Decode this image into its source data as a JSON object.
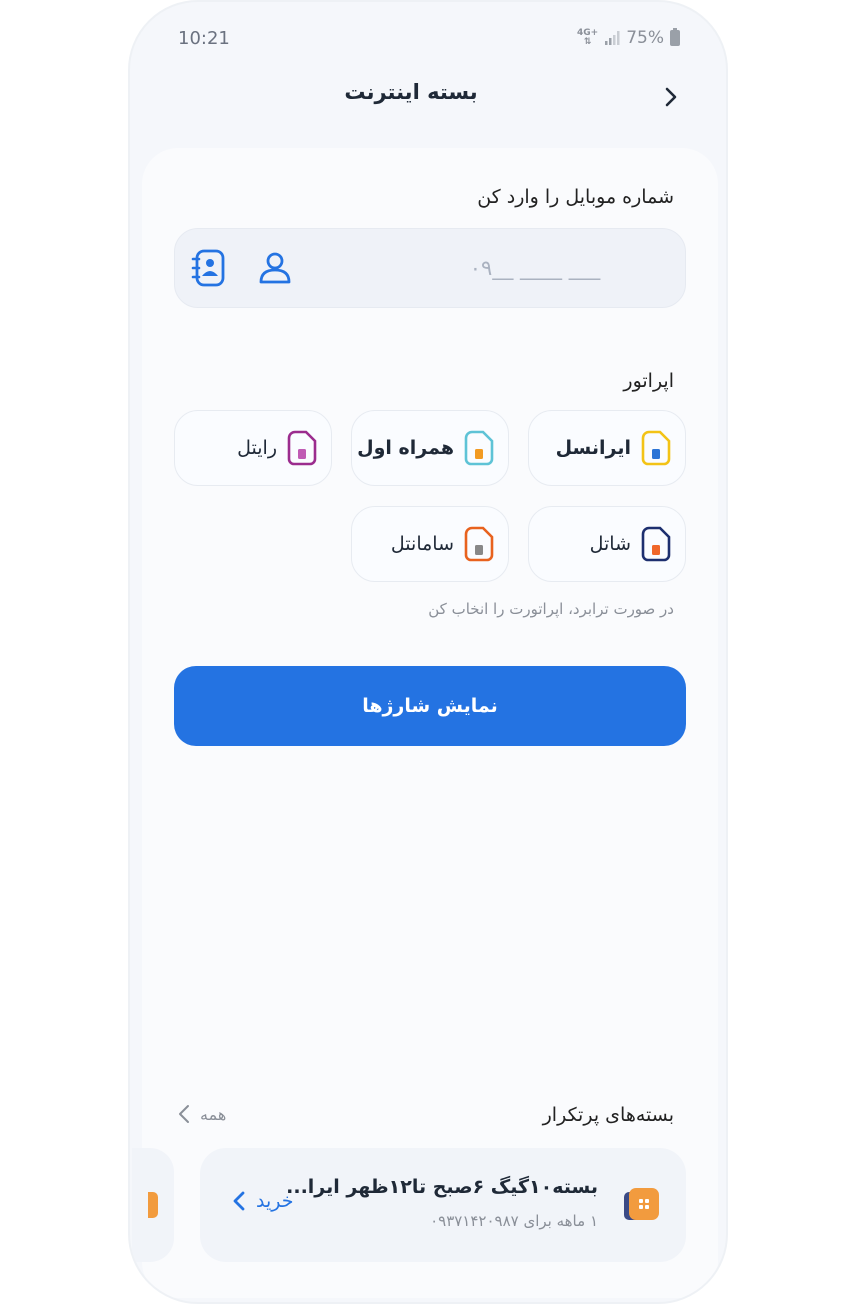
{
  "status_bar": {
    "time": "10:21",
    "network": "4G+",
    "battery": "75%"
  },
  "header": {
    "title": "بسته اینترنت"
  },
  "mobile": {
    "label": "شماره موبایل را وارد کن",
    "placeholder": "۰۹__ ____ ___",
    "value": ""
  },
  "operator": {
    "label": "اپراتور",
    "items": [
      {
        "name": "ایرانسل",
        "icon": "irancell-sim-icon",
        "frame_color": "#f3c316",
        "chip_color": "#2b74d6"
      },
      {
        "name": "همراه اول",
        "icon": "hamrahe-aval-sim-icon",
        "frame_color": "#5ec3d6",
        "chip_color": "#f29b22"
      },
      {
        "name": "رایتل",
        "icon": "rightel-sim-icon",
        "frame_color": "#9b2c8e",
        "chip_color": "#c05bb4"
      },
      {
        "name": "شاتل",
        "icon": "shatel-sim-icon",
        "frame_color": "#1d2f6f",
        "chip_color": "#f0672a"
      },
      {
        "name": "سامانتل",
        "icon": "samantel-sim-icon",
        "frame_color": "#e8621e",
        "chip_color": "#888888"
      }
    ],
    "hint": "در صورت ترابرد، اپراتورت را انخاب کن"
  },
  "submit": {
    "label": "نمایش شارژها"
  },
  "frequent": {
    "title": "بسته‌های پرتکرار",
    "see_all": "همه",
    "package": {
      "title": "بسته۱۰گیگ ۶صبح تا۱۲ظهر ایرا...",
      "subtitle": "۱ ماهه برای ۰۹۳۷۱۴۲۰۹۸۷",
      "buy": "خرید"
    }
  },
  "colors": {
    "primary": "#2473e2",
    "orange": "#f29b3e"
  }
}
